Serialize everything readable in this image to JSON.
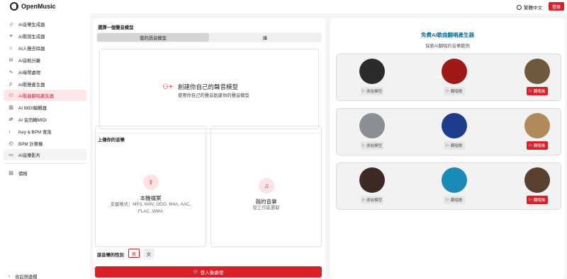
{
  "header": {
    "logo_text": "OpenMusic",
    "language": "繁體中文",
    "login_label": "登錄"
  },
  "sidebar": {
    "items": [
      {
        "label": "AI音樂生成器",
        "icon": "music-note-icon"
      },
      {
        "label": "AI歌詞生成器",
        "icon": "lyrics-icon"
      },
      {
        "label": "AI人聲去除器",
        "icon": "vocal-remover-icon"
      },
      {
        "label": "AI音軌分離",
        "icon": "stem-split-icon"
      },
      {
        "label": "AI母帶處理",
        "icon": "mastering-icon"
      },
      {
        "label": "AI歌聲產生器",
        "icon": "singing-icon"
      },
      {
        "label": "AI歌曲翻唱產生器",
        "icon": "cover-icon"
      },
      {
        "label": "AI MIDI編輯器",
        "icon": "midi-icon"
      },
      {
        "label": "AI 音訊轉MIDI",
        "icon": "audio-to-midi-icon"
      },
      {
        "label": "Key & BPM 查詢",
        "icon": "key-bpm-icon"
      },
      {
        "label": "BPM 計算機",
        "icon": "bpm-icon"
      },
      {
        "label": "AI音樂影片",
        "icon": "video-icon"
      }
    ],
    "pricing_label": "價格",
    "collapse_label": "收起側邊欄",
    "active_index": 6
  },
  "main": {
    "select_model_label": "選擇一個聲音模型",
    "tabs": [
      "我的語音模型",
      "庫"
    ],
    "create": {
      "title": "創建你自己的聲音模型",
      "subtitle": "使用你自己的聲音創建你的聲音模型"
    },
    "upload_label": "上傳你的音樂",
    "local_file": {
      "title": "本機檔案",
      "formats": "支援格式：MP3, WAV, OGG, M4A, AAC, FLAC, WMA"
    },
    "my_music": {
      "title": "我的音樂",
      "subtitle": "從工作區選取"
    },
    "gender_label": "該音樂的性別",
    "gender_options": [
      "男",
      "女"
    ],
    "gender_selected": "男",
    "submit_label": "登入後處理"
  },
  "right": {
    "title": "免費AI歌曲翻唱產生器",
    "subtitle": "探索AI翻唱的音樂範例",
    "btn_original": "原始模型",
    "btn_cover_song": "翻唱歌",
    "btn_cover": "翻唱後",
    "cards": [
      {
        "avatars": [
          "#2b2b2b",
          "#a01818",
          "#6e5a3c"
        ]
      },
      {
        "avatars": [
          "#8a8f96",
          "#1e3c8c",
          "#b08a5a"
        ]
      },
      {
        "avatars": [
          "#3d2a24",
          "#1a8ab8",
          "#5a4030"
        ]
      }
    ]
  }
}
